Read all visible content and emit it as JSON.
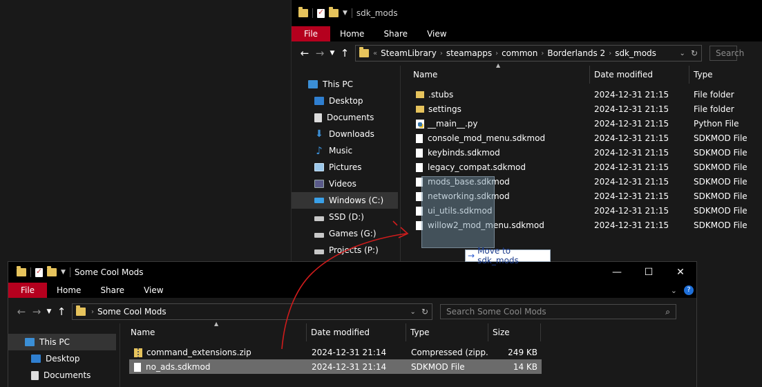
{
  "accent": "#b5001e",
  "dragArrowColor": "#d01c1c",
  "winA": {
    "title": "sdk_mods",
    "ribbon": {
      "file": "File",
      "home": "Home",
      "share": "Share",
      "view": "View"
    },
    "path": [
      "SteamLibrary",
      "steamapps",
      "common",
      "Borderlands 2",
      "sdk_mods"
    ],
    "path_prefix": "«",
    "search_placeholder": "Search",
    "nav": [
      {
        "label": "This PC",
        "icon": "pc-icon"
      },
      {
        "label": "Desktop",
        "icon": "desktop-icon"
      },
      {
        "label": "Documents",
        "icon": "documents-icon"
      },
      {
        "label": "Downloads",
        "icon": "downloads-icon"
      },
      {
        "label": "Music",
        "icon": "music-icon"
      },
      {
        "label": "Pictures",
        "icon": "pictures-icon"
      },
      {
        "label": "Videos",
        "icon": "videos-icon"
      },
      {
        "label": "Windows (C:)",
        "icon": "windows-drive-icon"
      },
      {
        "label": "SSD (D:)",
        "icon": "drive-icon"
      },
      {
        "label": "Games (G:)",
        "icon": "drive-icon"
      },
      {
        "label": "Projects (P:)",
        "icon": "drive-icon"
      }
    ],
    "columns": {
      "name": "Name",
      "date": "Date modified",
      "type": "Type"
    },
    "files": [
      {
        "name": ".stubs",
        "date": "2024-12-31 21:15",
        "type": "File folder",
        "icon": "folder-icon"
      },
      {
        "name": "settings",
        "date": "2024-12-31 21:15",
        "type": "File folder",
        "icon": "folder-icon"
      },
      {
        "name": "__main__.py",
        "date": "2024-12-31 21:15",
        "type": "Python File",
        "icon": "python-file-icon"
      },
      {
        "name": "console_mod_menu.sdkmod",
        "date": "2024-12-31 21:15",
        "type": "SDKMOD File",
        "icon": "file-icon"
      },
      {
        "name": "keybinds.sdkmod",
        "date": "2024-12-31 21:15",
        "type": "SDKMOD File",
        "icon": "file-icon"
      },
      {
        "name": "legacy_compat.sdkmod",
        "date": "2024-12-31 21:15",
        "type": "SDKMOD File",
        "icon": "file-icon"
      },
      {
        "name": "mods_base.sdkmod",
        "date": "2024-12-31 21:15",
        "type": "SDKMOD File",
        "icon": "file-icon"
      },
      {
        "name": "networking.sdkmod",
        "date": "2024-12-31 21:15",
        "type": "SDKMOD File",
        "icon": "file-icon"
      },
      {
        "name": "ui_utils.sdkmod",
        "date": "2024-12-31 21:15",
        "type": "SDKMOD File",
        "icon": "file-icon"
      },
      {
        "name": "willow2_mod_menu.sdkmod",
        "date": "2024-12-31 21:15",
        "type": "SDKMOD File",
        "icon": "file-icon"
      }
    ]
  },
  "tooltip": {
    "text": "Move to sdk_mods",
    "icon": "move-arrow-icon"
  },
  "winB": {
    "title": "Some Cool Mods",
    "ribbon": {
      "file": "File",
      "home": "Home",
      "share": "Share",
      "view": "View"
    },
    "path": [
      "Some Cool Mods"
    ],
    "search_placeholder": "Search Some Cool Mods",
    "nav": [
      {
        "label": "This PC",
        "icon": "pc-icon"
      },
      {
        "label": "Desktop",
        "icon": "desktop-icon"
      },
      {
        "label": "Documents",
        "icon": "documents-icon"
      }
    ],
    "columns": {
      "name": "Name",
      "date": "Date modified",
      "type": "Type",
      "size": "Size"
    },
    "files": [
      {
        "name": "command_extensions.zip",
        "date": "2024-12-31 21:14",
        "type": "Compressed (zipp...",
        "size": "249 KB",
        "icon": "zip-icon"
      },
      {
        "name": "no_ads.sdkmod",
        "date": "2024-12-31 21:14",
        "type": "SDKMOD File",
        "size": "14 KB",
        "icon": "file-icon"
      }
    ]
  }
}
